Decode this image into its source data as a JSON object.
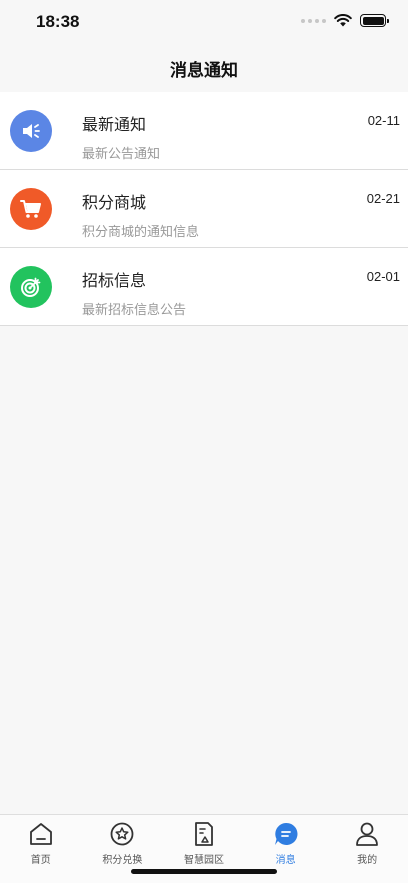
{
  "status_bar": {
    "time": "18:38"
  },
  "nav": {
    "title": "消息通知"
  },
  "messages": [
    {
      "title": "最新通知",
      "subtitle": "最新公告通知",
      "date": "02-11",
      "icon": "megaphone-icon",
      "color": "#5b86e5"
    },
    {
      "title": "积分商城",
      "subtitle": "积分商城的通知信息",
      "date": "02-21",
      "icon": "cart-icon",
      "color": "#f05a28"
    },
    {
      "title": "招标信息",
      "subtitle": "最新招标信息公告",
      "date": "02-01",
      "icon": "target-icon",
      "color": "#22c35e"
    }
  ],
  "tabs": [
    {
      "label": "首页",
      "icon": "home-icon",
      "active": false
    },
    {
      "label": "积分兑换",
      "icon": "star-icon",
      "active": false
    },
    {
      "label": "智慧园区",
      "icon": "document-icon",
      "active": false
    },
    {
      "label": "消息",
      "icon": "message-icon",
      "active": true
    },
    {
      "label": "我的",
      "icon": "user-icon",
      "active": false
    }
  ],
  "colors": {
    "accent": "#2f7de1",
    "background": "#f7f7f7"
  }
}
